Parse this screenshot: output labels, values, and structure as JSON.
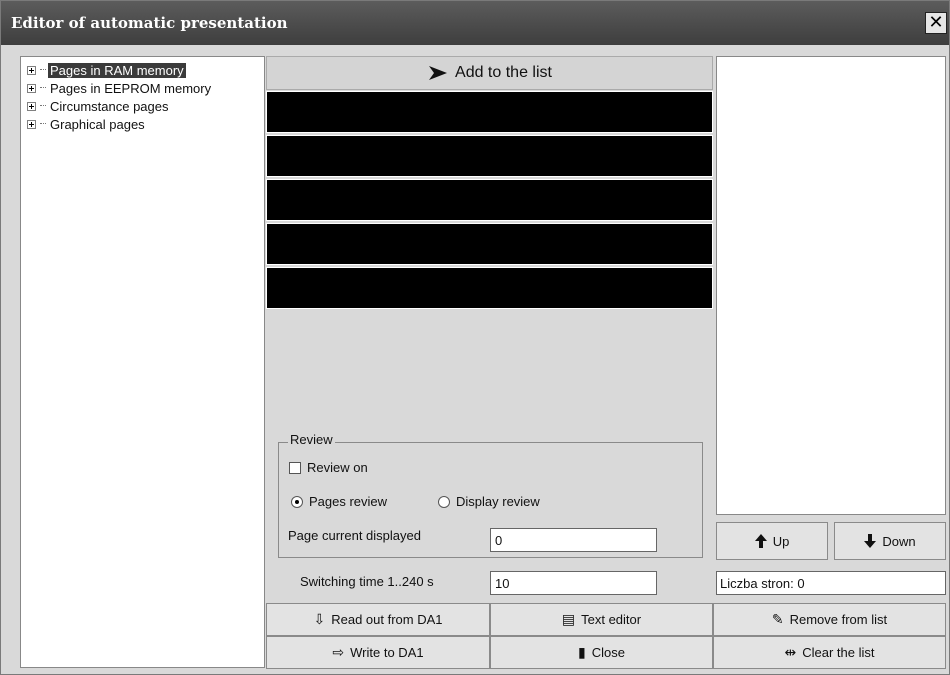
{
  "window": {
    "title": "Editor of automatic presentation",
    "close_glyph": "✕"
  },
  "tree": {
    "items": [
      {
        "label": "Pages in RAM memory",
        "selected": true
      },
      {
        "label": "Pages in EEPROM memory",
        "selected": false
      },
      {
        "label": "Circumstance pages",
        "selected": false
      },
      {
        "label": "Graphical pages",
        "selected": false
      }
    ]
  },
  "add_button": {
    "label": "Add to the list",
    "icon": "arrow-right-icon"
  },
  "review": {
    "legend": "Review",
    "review_on_label": "Review on",
    "review_on_checked": false,
    "pages_review_label": "Pages review",
    "display_review_label": "Display review",
    "selected_mode": "pages",
    "page_current_label": "Page current displayed",
    "page_current_value": "0"
  },
  "switching": {
    "label": "Switching time 1..240 s",
    "value": "10"
  },
  "nav": {
    "up_label": "Up",
    "down_label": "Down"
  },
  "count_text": "Liczba stron: 0",
  "buttons": {
    "read_out": "Read out from DA1",
    "text_editor": "Text editor",
    "remove": "Remove from list",
    "write": "Write to DA1",
    "close": "Close",
    "clear": "Clear the list"
  }
}
